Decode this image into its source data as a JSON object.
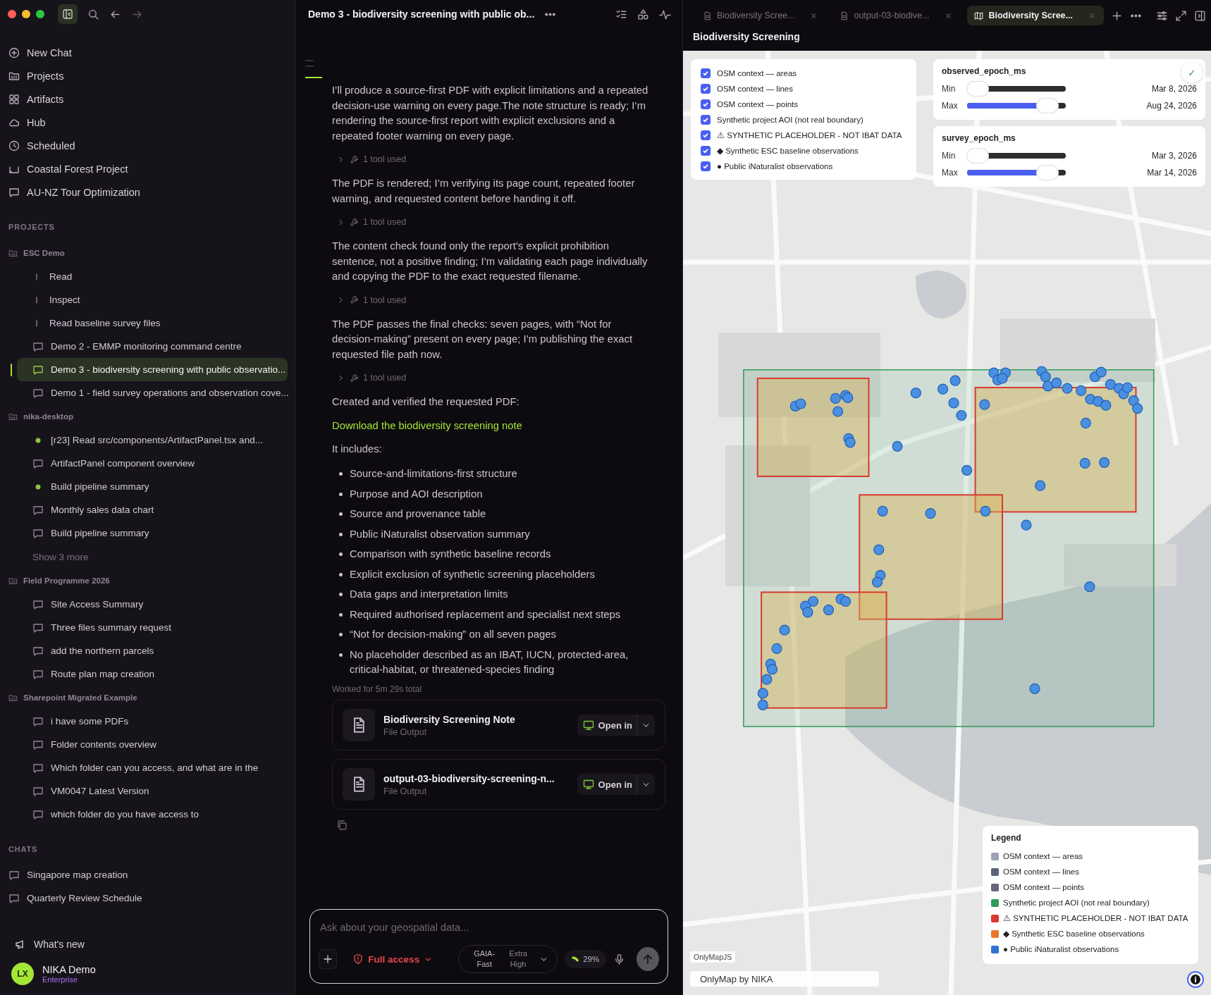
{
  "sidebar": {
    "nav": [
      {
        "kind": "new",
        "label": "New Chat"
      },
      {
        "kind": "folder",
        "label": "Projects"
      },
      {
        "kind": "grid",
        "label": "Artifacts"
      },
      {
        "kind": "cloud",
        "label": "Hub"
      },
      {
        "kind": "clock",
        "label": "Scheduled"
      },
      {
        "kind": "tray",
        "label": "Coastal Forest Project"
      },
      {
        "kind": "chat",
        "label": "AU-NZ Tour Optimization"
      }
    ],
    "projects_heading": "PROJECTS",
    "projects": [
      {
        "name": "ESC Demo",
        "items": [
          {
            "kind": "step",
            "label": "Read",
            "selected": false
          },
          {
            "kind": "step",
            "label": "Inspect",
            "selected": false
          },
          {
            "kind": "step",
            "label": "Read baseline survey files",
            "selected": false
          },
          {
            "kind": "chat",
            "label": "Demo 2 - EMMP monitoring command centre",
            "selected": false
          },
          {
            "kind": "chat",
            "label": "Demo 3 - biodiversity screening with public observatio...",
            "selected": true
          },
          {
            "kind": "chat",
            "label": "Demo 1 - field survey operations and observation cove...",
            "selected": false
          }
        ]
      },
      {
        "name": "nika-desktop",
        "items": [
          {
            "kind": "dot",
            "label": "[r23] Read src/components/ArtifactPanel.tsx and...",
            "selected": false
          },
          {
            "kind": "chat",
            "label": "ArtifactPanel component overview",
            "selected": false
          },
          {
            "kind": "dot",
            "label": "Build pipeline summary",
            "selected": false
          },
          {
            "kind": "chat",
            "label": "Monthly sales data chart",
            "selected": false
          },
          {
            "kind": "chat",
            "label": "Build pipeline summary",
            "selected": false
          }
        ],
        "more": "Show 3 more"
      },
      {
        "name": "Field Programme 2026",
        "items": [
          {
            "kind": "chat",
            "label": "Site Access Summary",
            "selected": false
          },
          {
            "kind": "chat",
            "label": "Three files summary request",
            "selected": false
          },
          {
            "kind": "chat",
            "label": "add the northern parcels",
            "selected": false
          },
          {
            "kind": "chat",
            "label": "Route plan map creation",
            "selected": false
          }
        ]
      },
      {
        "name": "Sharepoint Migrated Example",
        "items": [
          {
            "kind": "chat",
            "label": "i have some PDFs",
            "selected": false
          },
          {
            "kind": "chat",
            "label": "Folder contents overview",
            "selected": false
          },
          {
            "kind": "chat",
            "label": "Which folder can you access, and what are in the",
            "selected": false
          },
          {
            "kind": "chat",
            "label": "VM0047 Latest Version",
            "selected": false
          },
          {
            "kind": "chat",
            "label": "which folder do you have access to",
            "selected": false
          }
        ]
      }
    ],
    "chats_heading": "CHATS",
    "chats": [
      {
        "kind": "chat",
        "label": "Singapore map creation",
        "selected": false
      },
      {
        "kind": "chat",
        "label": "Quarterly Review Schedule",
        "selected": false
      }
    ],
    "whats_new": "What's new",
    "user": {
      "initials": "LX",
      "name": "NIKA Demo",
      "plan": "Enterprise"
    }
  },
  "chat": {
    "title": "Demo 3 - biodiversity screening with public ob...",
    "messages": [
      {
        "kind": "text",
        "text": "I’ll produce a source-first PDF with explicit limitations and a repeated decision-use warning on every page.The note structure is ready; I’m rendering the source-first report with explicit exclusions and a repeated footer warning on every page."
      },
      {
        "kind": "tool",
        "text": "1 tool used"
      },
      {
        "kind": "text",
        "text": "The PDF is rendered; I’m verifying its page count, repeated footer warning, and requested content before handing it off."
      },
      {
        "kind": "tool",
        "text": "1 tool used"
      },
      {
        "kind": "text",
        "text": "The content check found only the report’s explicit prohibition sentence, not a positive finding; I’m validating each page individually and copying the PDF to the exact requested filename."
      },
      {
        "kind": "tool",
        "text": "1 tool used"
      },
      {
        "kind": "text",
        "text": "The PDF passes the final checks: seven pages, with “Not for decision-making” present on every page; I’m publishing the exact requested file path now."
      },
      {
        "kind": "tool",
        "text": "1 tool used"
      },
      {
        "kind": "text",
        "text": "Created and verified the requested PDF:"
      },
      {
        "kind": "link",
        "text": "Download the biodiversity screening note"
      },
      {
        "kind": "text",
        "text": "It includes:"
      },
      {
        "kind": "list",
        "items": [
          "Source-and-limitations-first structure",
          "Purpose and AOI description",
          "Source and provenance table",
          "Public iNaturalist observation summary",
          "Comparison with synthetic baseline records",
          "Explicit exclusion of synthetic screening placeholders",
          "Data gaps and interpretation limits",
          "Required authorised replacement and specialist next steps",
          "“Not for decision-making” on all seven pages",
          "No placeholder described as an IBAT, IUCN, protected-area, critical-habitat, or threatened-species finding"
        ]
      },
      {
        "kind": "meta",
        "text": "Worked for 5m 29s total"
      }
    ],
    "files": [
      {
        "name": "Biodiversity Screening Note",
        "type": "File Output",
        "action": "Open in"
      },
      {
        "name": "output-03-biodiversity-screening-n...",
        "type": "File Output",
        "action": "Open in"
      }
    ],
    "composer": {
      "placeholder": "Ask about your geospatial data...",
      "access": "Full access",
      "model": "GAIA-Fast",
      "effort": "Extra High",
      "context": "29%"
    }
  },
  "map": {
    "tabs": [
      {
        "kind": "doc",
        "label": "Biodiversity Scree...",
        "selected": false
      },
      {
        "kind": "doc",
        "label": "output-03-biodive...",
        "selected": false
      },
      {
        "kind": "map",
        "label": "Biodiversity Scree...",
        "selected": true
      }
    ],
    "title": "Biodiversity Screening",
    "layers": [
      {
        "label": "OSM context — areas",
        "checked": true
      },
      {
        "label": "OSM context — lines",
        "checked": true
      },
      {
        "label": "OSM context — points",
        "checked": true
      },
      {
        "label": "Synthetic project AOI (not real boundary)",
        "checked": true
      },
      {
        "label": "⚠ SYNTHETIC PLACEHOLDER - NOT IBAT DATA",
        "checked": true
      },
      {
        "label": "◆ Synthetic ESC baseline observations",
        "checked": true
      },
      {
        "label": "● Public iNaturalist observations",
        "checked": true
      }
    ],
    "filters": [
      {
        "field": "observed_epoch_ms",
        "confirm": "✓",
        "rows": [
          {
            "label": "Min",
            "level": 0,
            "value": "Mar 8, 2026"
          },
          {
            "label": "Max",
            "level": 0.9,
            "value": "Aug 24, 2026"
          }
        ]
      },
      {
        "field": "survey_epoch_ms",
        "rows": [
          {
            "label": "Min",
            "level": 0,
            "value": "Mar 3, 2026"
          },
          {
            "label": "Max",
            "level": 0.9,
            "value": "Mar 14, 2026"
          }
        ]
      }
    ],
    "legend": {
      "title": "Legend",
      "items": [
        {
          "label": "OSM context — areas",
          "color": "#9aa3b5"
        },
        {
          "label": "OSM context — lines",
          "color": "#5c6478"
        },
        {
          "label": "OSM context — points",
          "color": "#626878"
        },
        {
          "label": "Synthetic project AOI (not real boundary)",
          "color": "#2f9a5a"
        },
        {
          "label": "⚠ SYNTHETIC PLACEHOLDER - NOT IBAT DATA",
          "color": "#d93a2e"
        },
        {
          "label": "◆ Synthetic ESC baseline observations",
          "color": "#e8792b"
        },
        {
          "label": "● Public iNaturalist observations",
          "color": "#2f74d0"
        }
      ]
    },
    "attribution": "OnlyMapJS",
    "footer": "OnlyMap by NIKA"
  }
}
